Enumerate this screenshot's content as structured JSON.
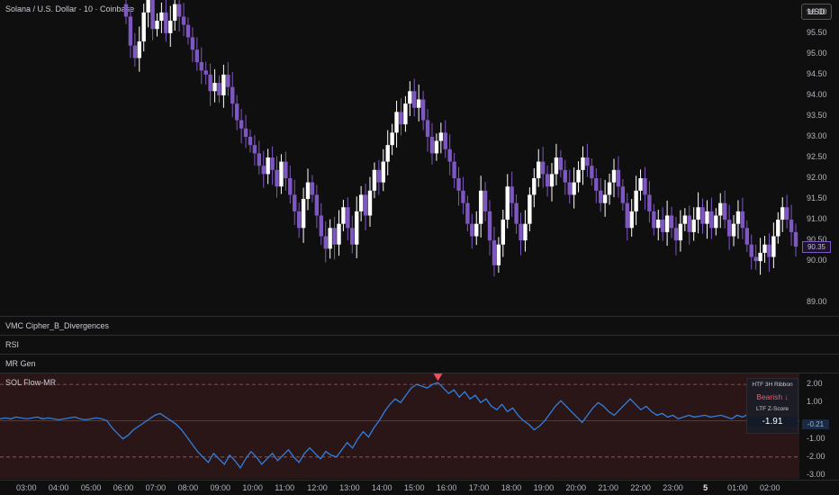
{
  "header": {
    "symbol_title": "Solana / U.S. Dollar · 10 · Coinbase",
    "currency_button": "USD"
  },
  "price_axis": {
    "ticks": [
      "96.00",
      "95.50",
      "95.00",
      "94.50",
      "94.00",
      "93.50",
      "93.00",
      "92.50",
      "92.00",
      "91.50",
      "91.00",
      "90.50",
      "90.00",
      "89.00"
    ],
    "last_price": "90.35"
  },
  "panes": {
    "cipher": "VMC Cipher_B_Divergences",
    "rsi": "RSI",
    "mrgen": "MR Gen",
    "flow": "SOL Flow-MR"
  },
  "flow_axis": {
    "ticks": [
      "2.00",
      "1.00",
      "-1.00",
      "-2.00",
      "-3.00"
    ],
    "last_value": "-0.21"
  },
  "legend": {
    "ribbon_label": "HTF 3H Ribbon",
    "ribbon_state": "Bearish ↓",
    "zscore_label": "LTF Z-Score",
    "zscore_value": "-1.91"
  },
  "time_axis": [
    "03:00",
    "04:00",
    "05:00",
    "06:00",
    "07:00",
    "08:00",
    "09:00",
    "10:00",
    "11:00",
    "12:00",
    "13:00",
    "14:00",
    "15:00",
    "16:00",
    "17:00",
    "18:00",
    "19:00",
    "20:00",
    "21:00",
    "22:00",
    "23:00",
    "5",
    "01:00",
    "02:00"
  ],
  "colors": {
    "bull_candle": "#ffffff",
    "bear_candle": "#7e57c2",
    "zscore_line": "#2f7fe0",
    "band_fill": "#2a1616",
    "signal_marker": "#f24d62"
  },
  "chart_data": [
    {
      "type": "candlestick",
      "title": "Solana / U.S. Dollar · 10 · Coinbase",
      "ylim": [
        88.7,
        96.3
      ],
      "close": [
        95.9,
        95.2,
        94.9,
        95.3,
        96.0,
        96.3,
        95.6,
        95.8,
        96.0,
        95.5,
        95.8,
        96.2,
        95.9,
        95.7,
        95.4,
        95.1,
        94.8,
        94.6,
        94.5,
        94.1,
        94.3,
        94.0,
        94.5,
        94.2,
        93.8,
        93.4,
        93.2,
        93.0,
        92.8,
        92.6,
        92.3,
        92.1,
        92.5,
        92.2,
        91.8,
        92.4,
        92.0,
        91.6,
        91.2,
        90.8,
        91.5,
        91.9,
        91.6,
        91.1,
        90.6,
        90.3,
        90.8,
        90.4,
        90.9,
        91.3,
        90.8,
        90.4,
        91.2,
        91.6,
        91.1,
        91.7,
        92.2,
        91.9,
        92.4,
        92.8,
        93.1,
        93.6,
        93.3,
        93.8,
        94.1,
        93.7,
        93.9,
        93.4,
        93.0,
        92.6,
        92.9,
        93.1,
        92.7,
        92.4,
        92.0,
        91.7,
        91.4,
        90.9,
        90.6,
        90.9,
        91.7,
        91.2,
        90.5,
        89.9,
        90.4,
        91.0,
        91.8,
        91.4,
        90.9,
        90.5,
        90.9,
        91.6,
        92.0,
        92.4,
        92.1,
        91.8,
        92.1,
        92.5,
        92.2,
        91.9,
        91.6,
        91.9,
        92.2,
        92.5,
        92.3,
        92.0,
        91.7,
        91.4,
        91.6,
        91.9,
        92.2,
        91.8,
        91.4,
        90.8,
        91.2,
        91.7,
        92.0,
        91.6,
        91.2,
        90.8,
        91.0,
        90.7,
        91.1,
        90.8,
        90.5,
        90.9,
        91.1,
        90.7,
        91.0,
        91.3,
        90.9,
        91.2,
        90.8,
        91.1,
        91.4,
        91.0,
        90.6,
        90.9,
        91.2,
        90.8,
        90.4,
        90.1,
        90.0,
        90.2,
        90.4,
        90.1,
        90.6,
        91.0,
        91.3,
        91.0,
        90.7,
        90.35
      ],
      "note_candles": "approximate reading of visible candles"
    },
    {
      "type": "line",
      "title": "SOL Flow-MR",
      "ylim": [
        -3.2,
        2.6
      ],
      "hlines": [
        2.0,
        0.0,
        -2.0
      ],
      "series": [
        {
          "values": [
            0.1,
            0.15,
            0.1,
            0.2,
            0.15,
            0.1,
            0.15,
            0.2,
            0.1,
            0.15,
            0.1,
            0.05,
            0.1,
            0.15,
            0.2,
            0.1,
            0.05,
            0.1,
            0.15,
            0.1,
            0.0,
            -0.4,
            -0.7,
            -1.0,
            -0.8,
            -0.5,
            -0.3,
            -0.1,
            0.1,
            0.3,
            0.4,
            0.2,
            0.0,
            -0.2,
            -0.5,
            -0.9,
            -1.3,
            -1.7,
            -2.0,
            -2.3,
            -1.8,
            -2.1,
            -2.4,
            -1.9,
            -2.2,
            -2.6,
            -2.1,
            -1.7,
            -2.0,
            -2.4,
            -2.1,
            -1.8,
            -2.2,
            -1.9,
            -1.6,
            -2.0,
            -2.3,
            -1.8,
            -1.5,
            -1.8,
            -2.1,
            -1.7,
            -1.9,
            -2.0,
            -1.6,
            -1.2,
            -1.5,
            -1.0,
            -0.6,
            -0.9,
            -0.4,
            0.0,
            0.5,
            0.9,
            1.2,
            1.0,
            1.4,
            1.8,
            2.0,
            1.9,
            1.8,
            2.0,
            2.1,
            1.8,
            1.5,
            1.7,
            1.3,
            1.6,
            1.2,
            1.4,
            1.0,
            1.2,
            0.8,
            0.6,
            0.9,
            0.5,
            0.7,
            0.3,
            0.0,
            -0.2,
            -0.5,
            -0.3,
            0.0,
            0.4,
            0.8,
            1.1,
            0.8,
            0.5,
            0.2,
            -0.1,
            0.3,
            0.7,
            1.0,
            0.8,
            0.5,
            0.3,
            0.6,
            0.9,
            1.2,
            0.9,
            0.6,
            0.8,
            0.5,
            0.3,
            0.4,
            0.2,
            0.3,
            0.1,
            0.2,
            0.3,
            0.2,
            0.25,
            0.3,
            0.2,
            0.25,
            0.3,
            0.2,
            0.1,
            0.3,
            0.2,
            0.35,
            0.4,
            0.3,
            0.2,
            0.1,
            0.0,
            -0.2,
            -0.15,
            -0.2,
            -0.21
          ],
          "color": "#2f7fe0"
        }
      ],
      "markers": [
        {
          "type": "down-triangle",
          "at_value": 2.0,
          "color": "#f24d62"
        }
      ]
    }
  ]
}
